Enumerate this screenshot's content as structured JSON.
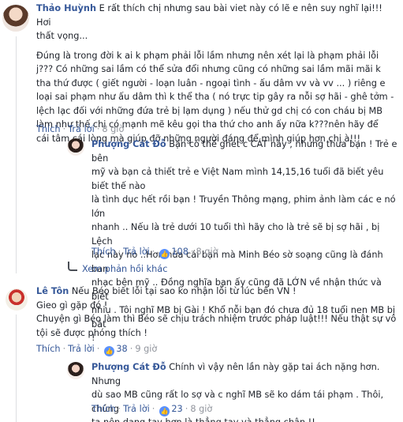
{
  "thread": {
    "comments": [
      {
        "author": "Thảo Huỳnh",
        "lines": [
          "E rất thích chị nhưng sau bài viet này có lẽ e nên suy nghĩ lại!!! Hơi",
          "thất vọng...",
          "Đúng là trong đời k ai k phạm phải lỗi lầm nhưng nên xét lại là phạm phải lỗi",
          "j??? Có những sai lầm có thể sửa đổi nhưng cũng có những sai lầm mãi mãi k",
          "tha thứ được ( giết người - loạn luân - ngoại tình - ấu dâm vv và vv ... ) riêng e",
          "loại sai phạm như ấu dâm thì k thể tha ( nó trực tip gây ra nỗi sợ hãi - ghê tởm -",
          "lệch lạc đối với những đứa trẻ bị lạm dụng ) nếu thử gd chị có con cháu bị MB",
          "làm như thế chị có mạnh mẽ kêu gọi tha thứ cho anh ấy nữa k???nên hãy để",
          "cái tâm cái lòng mà giúp đỡ những người đáng để mình giúp hơn chị à!!!"
        ],
        "actions": {
          "like": "Thích",
          "reply": "Trả lời",
          "time": "8 giờ"
        }
      },
      {
        "author": "Phượng Cát Đỗ",
        "lines": [
          "Bạn có thể ghét c CÁT này , nhưng thưa bạn ! Trẻ e bên",
          "mỹ và bạn cả thiết trẻ e Việt Nam mình 14,15,16 tuổi đã biết yêu biết thế nào",
          "là tình dục hết rồi bạn ! Truyền Thông mạng, phim ảnh làm các e nó lớn",
          "nhanh .. Nếu là trẻ dưới 10 tuổi thì hãy cho là trẻ sẽ bị sợ hãi , bị Lệch",
          "lạc này no ..Hơn nữa cái bạn mà Minh Béo sờ soạng cũng là đánh ban",
          "nhạc bên mỹ .. Đồng nghĩa bạn ấy cũng đã LỚN về nhận thức và biết",
          "nhiu . Tôi nghĩ MB bị Gài ! Khổ nỗi bạn đó chưa đủ 18 tuổi nen MB bị bắt",
          "!"
        ],
        "actions": {
          "like": "Thích",
          "reply": "Trả lời",
          "likes": "108",
          "time": "8 giờ"
        }
      },
      {
        "author": "Lê Tôn",
        "lines": [
          "Nếu Béo biết lỗi tại sao ko nhận lỗi từ lúc bên VN !",
          "Gieo gì gặp đó !",
          "Chuyện gì Béo làm thì Béo sẽ chịu trách nhiệm trước pháp luật!!! Nếu thật sự vô",
          "tội sẽ được phóng thích !"
        ],
        "actions": {
          "like": "Thích",
          "reply": "Trả lời",
          "likes": "38",
          "time": "9 giờ"
        }
      },
      {
        "author": "Phượng Cát Đỗ",
        "lines": [
          "Chính vì vậy nên lần này gặp tai ách nặng hơn. Nhưng",
          "dù sao MB cũng rất lo sợ và c nghĩ MB sẽ ko dám tái phạm . Thôi, chúng",
          "ta nên dang tay hơn là thẳng tay và thẳng chân !!"
        ],
        "actions": {
          "like": "Thích",
          "reply": "Trả lời",
          "likes": "23",
          "time": "8 giờ"
        }
      }
    ],
    "view_replies": "Xem phản hồi khác"
  },
  "icons": {
    "like": "thumbs-up-icon",
    "reply": "reply-arrow-icon"
  },
  "colors": {
    "name": "#365899",
    "text": "#1d2129",
    "meta": "#90949c",
    "like_badge": "#5890ff"
  }
}
